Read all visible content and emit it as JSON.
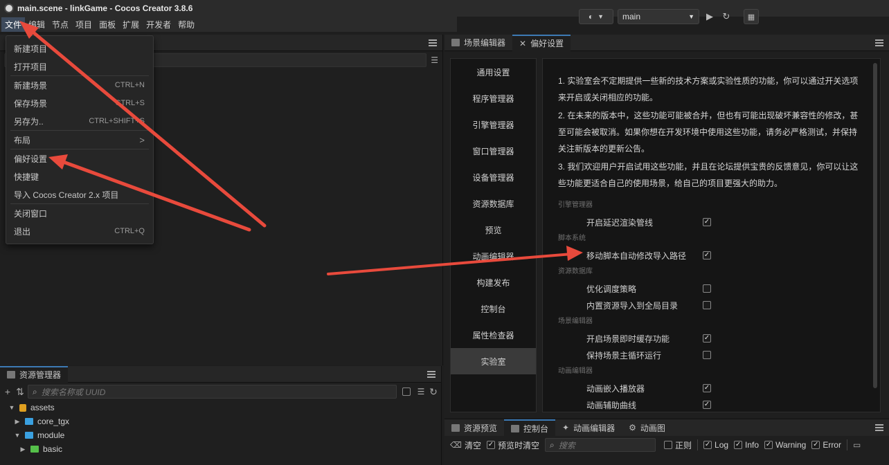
{
  "window": {
    "title": "main.scene - linkGame - Cocos Creator 3.8.6"
  },
  "menubar": [
    "文件",
    "编辑",
    "节点",
    "项目",
    "面板",
    "扩展",
    "开发者",
    "帮助"
  ],
  "toolbar": {
    "scene": "main"
  },
  "file_menu": {
    "items": [
      {
        "label": "新建项目",
        "shortcut": ""
      },
      {
        "label": "打开项目",
        "shortcut": ""
      },
      {
        "label": "新建场景",
        "shortcut": "CTRL+N"
      },
      {
        "label": "保存场景",
        "shortcut": "CTRL+S"
      },
      {
        "label": "另存为..",
        "shortcut": "CTRL+SHIFT+S"
      },
      {
        "label": "布局",
        "shortcut": ">"
      },
      {
        "label": "偏好设置",
        "shortcut": ""
      },
      {
        "label": "快捷键",
        "shortcut": ""
      },
      {
        "label": "导入 Cocos Creator 2.x 项目",
        "shortcut": ""
      },
      {
        "label": "关闭窗口",
        "shortcut": ""
      },
      {
        "label": "退出",
        "shortcut": "CTRL+Q"
      }
    ]
  },
  "assets_panel": {
    "tab": "资源管理器",
    "search_placeholder": "搜索名称或 UUID",
    "tree": [
      "assets",
      "core_tgx",
      "module",
      "basic"
    ]
  },
  "right_tabs": [
    "场景编辑器",
    "偏好设置"
  ],
  "prefs_nav": [
    "通用设置",
    "程序管理器",
    "引擎管理器",
    "窗口管理器",
    "设备管理器",
    "资源数据库",
    "预览",
    "动画编辑器",
    "构建发布",
    "控制台",
    "属性检查器",
    "实验室"
  ],
  "prefs_content": {
    "paragraphs": [
      "1. 实验室会不定期提供一些新的技术方案或实验性质的功能，你可以通过开关选项来开启或关闭相应的功能。",
      "2. 在未来的版本中，这些功能可能被合并，但也有可能出现破坏兼容性的修改，甚至可能会被取消。如果你想在开发环境中使用这些功能，请务必严格测试，并保持关注新版本的更新公告。",
      "3. 我们欢迎用户开启试用这些功能，并且在论坛提供宝贵的反馈意见，你可以让这些功能更适合自己的使用场景，给自己的项目更强大的助力。"
    ],
    "sections": [
      {
        "title": "引擎管理器",
        "options": [
          {
            "label": "开启延迟渲染管线",
            "checked": true
          }
        ]
      },
      {
        "title": "脚本系统",
        "options": [
          {
            "label": "移动脚本自动修改导入路径",
            "checked": true
          }
        ]
      },
      {
        "title": "资源数据库",
        "options": [
          {
            "label": "优化调度策略",
            "checked": false
          },
          {
            "label": "内置资源导入到全局目录",
            "checked": false
          }
        ]
      },
      {
        "title": "场景编辑器",
        "options": [
          {
            "label": "开启场景即时缓存功能",
            "checked": true
          },
          {
            "label": "保持场景主循环运行",
            "checked": false
          }
        ]
      },
      {
        "title": "动画编辑器",
        "options": [
          {
            "label": "动画嵌入播放器",
            "checked": true
          },
          {
            "label": "动画辅助曲线",
            "checked": true
          }
        ]
      }
    ]
  },
  "console": {
    "tabs": [
      "资源预览",
      "控制台",
      "动画编辑器",
      "动画图"
    ],
    "clear": "清空",
    "preview_clear": "预览时清空",
    "search_placeholder": "搜索",
    "regex": "正则",
    "filters": [
      "Log",
      "Info",
      "Warning",
      "Error"
    ]
  },
  "colors": {
    "accent": "#3d7ab5",
    "arrow": "#e84a3c"
  }
}
